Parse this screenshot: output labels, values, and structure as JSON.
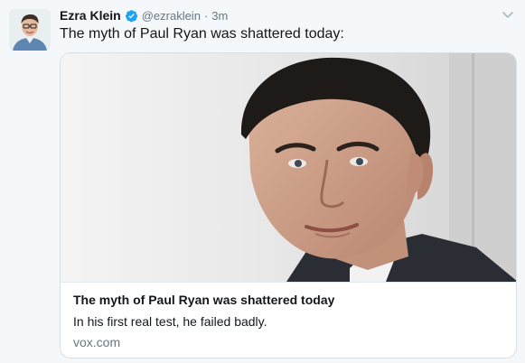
{
  "tweet": {
    "author_name": "Ezra Klein",
    "handle": "@ezraklein",
    "separator": "·",
    "timestamp": "3m",
    "text": "The myth of Paul Ryan was shattered today:"
  },
  "card": {
    "title": "The myth of Paul Ryan was shattered today",
    "description": "In his first real test, he failed badly.",
    "domain": "vox.com",
    "image_icon": "portrait-photo"
  },
  "icons": {
    "verified": "verified-badge-icon",
    "caret": "chevron-down-icon"
  },
  "colors": {
    "verified": "#1da1f2",
    "secondary_text": "#657786",
    "background": "#f5f8fa"
  }
}
